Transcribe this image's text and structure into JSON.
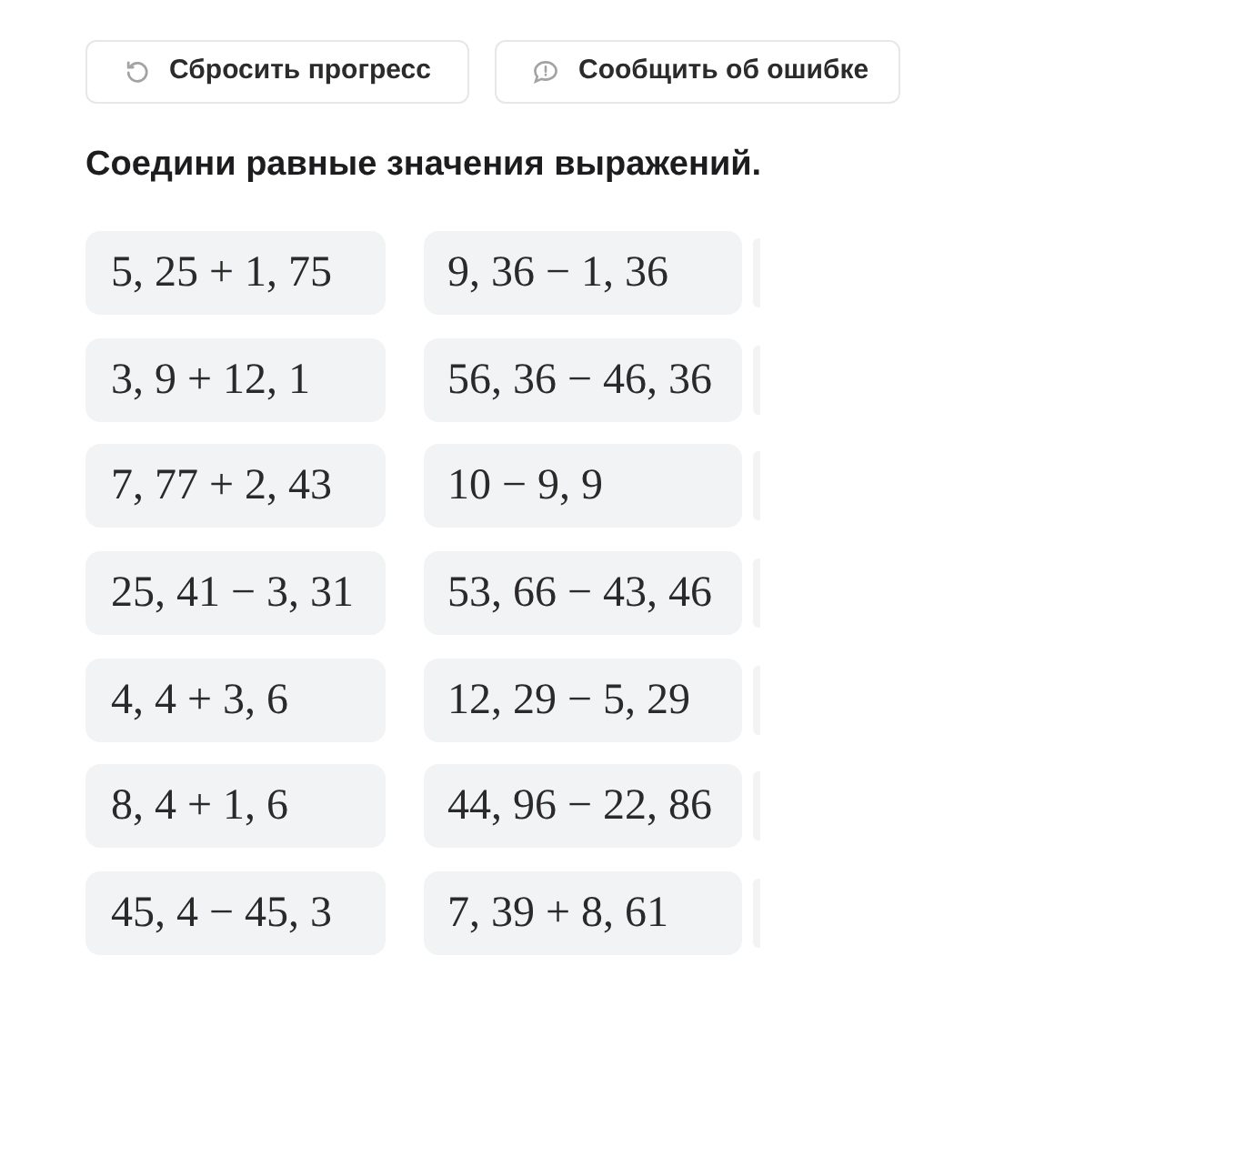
{
  "buttons": [
    {
      "label": "Сбросить прогресс",
      "kind": "reset"
    },
    {
      "label": "Сообщить об ошибке",
      "kind": "report"
    }
  ],
  "instruction": "Соедини равные значения выражений.",
  "pairs": [
    {
      "left": "5, 25 + 1, 75",
      "right": "9, 36 − 1, 36"
    },
    {
      "left": "3, 9 + 12, 1",
      "right": "56, 36 − 46, 36"
    },
    {
      "left": "7, 77 + 2, 43",
      "right": "10 − 9, 9"
    },
    {
      "left": "25, 41 − 3, 31",
      "right": "53, 66 − 43, 46"
    },
    {
      "left": "4, 4 + 3, 6",
      "right": "12, 29 − 5, 29"
    },
    {
      "left": "8, 4 + 1, 6",
      "right": "44, 96 − 22, 86"
    },
    {
      "left": "45, 4 − 45, 3",
      "right": "7, 39 + 8, 61"
    }
  ]
}
